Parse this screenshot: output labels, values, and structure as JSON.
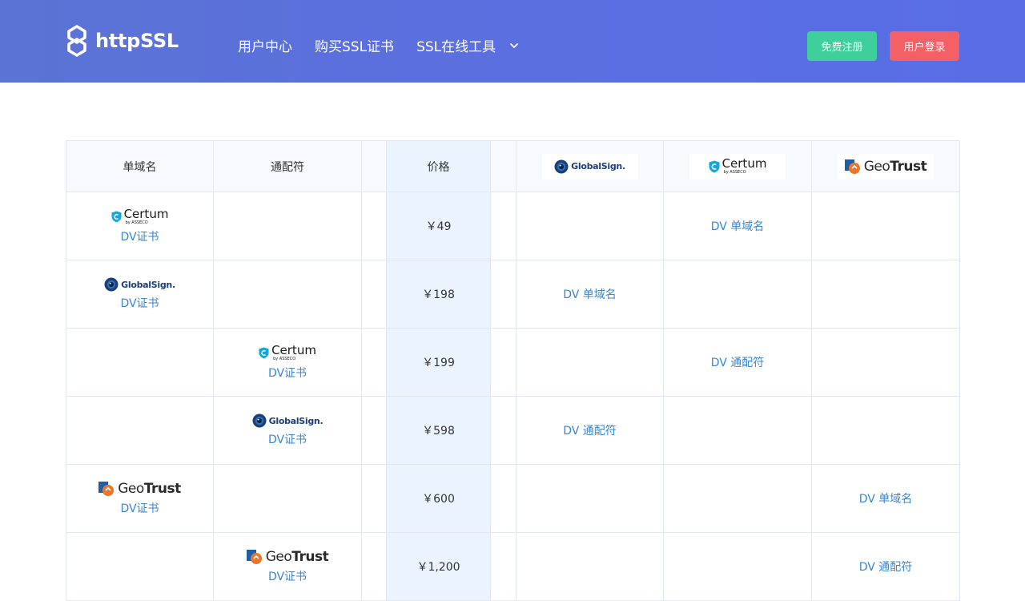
{
  "header": {
    "logo_text": "httpSSL",
    "nav": [
      {
        "label": "用户中心"
      },
      {
        "label": "购买SSL证书"
      },
      {
        "label": "SSL在线工具"
      }
    ],
    "register_label": "免费注册",
    "login_label": "用户登录"
  },
  "brands": {
    "globalsign": "GlobalSign.",
    "certum_main": "Certum",
    "certum_sub": "by ASSECO",
    "geotrust_a": "Geo",
    "geotrust_b": "Trust"
  },
  "table": {
    "headers": {
      "single": "单域名",
      "wildcard": "通配符",
      "price": "价格"
    },
    "rows": [
      {
        "product": "DV证书",
        "price": "￥49",
        "vendor_link": "DV 单域名"
      },
      {
        "product": "DV证书",
        "price": "￥198",
        "vendor_link": "DV 单域名"
      },
      {
        "product": "DV证书",
        "price": "￥199",
        "vendor_link": "DV 通配符"
      },
      {
        "product": "DV证书",
        "price": "￥598",
        "vendor_link": "DV 通配符"
      },
      {
        "product": "DV证书",
        "price": "￥600",
        "vendor_link": "DV 单域名"
      },
      {
        "product": "DV证书",
        "price": "￥1,200",
        "vendor_link": "DV 通配符"
      }
    ]
  },
  "colors": {
    "header_bg": "#5b6fe0",
    "register_btn": "#3fcf9b",
    "login_btn": "#f25f64",
    "link": "#3a86d2",
    "price_col_bg": "#ebf3fe"
  }
}
